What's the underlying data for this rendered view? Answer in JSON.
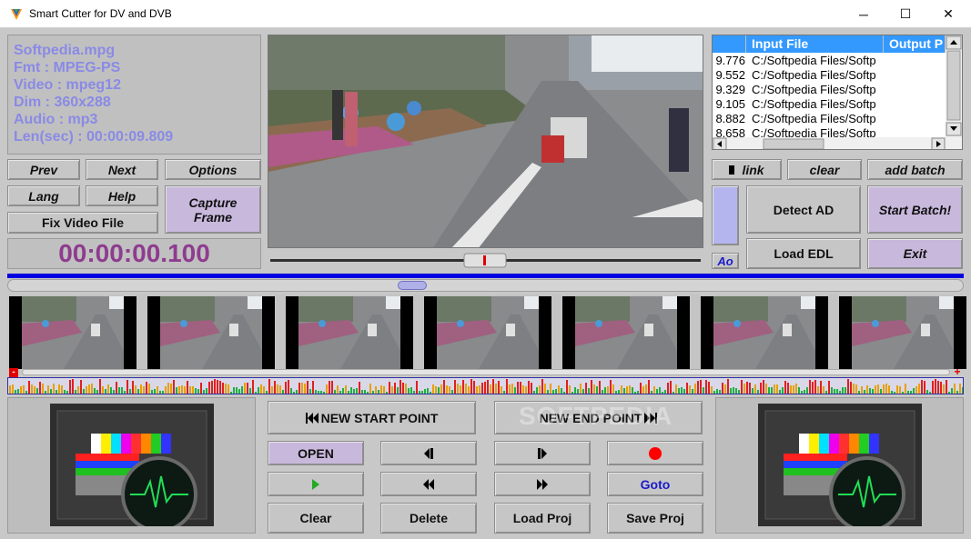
{
  "window": {
    "title": "Smart Cutter for DV and DVB",
    "minimize": "─",
    "maximize": "☐",
    "close": "✕"
  },
  "info": {
    "filename": "Softpedia.mpg",
    "fmt": "Fmt : MPEG-PS",
    "video": "Video : mpeg12",
    "dim": "Dim : 360x288",
    "audio": "Audio : mp3",
    "len": "Len(sec) : 00:00:09.809"
  },
  "left_buttons": {
    "prev": "Prev",
    "next": "Next",
    "options": "Options",
    "lang": "Lang",
    "help": "Help",
    "capture_frame": "Capture Frame",
    "fix_video_file": "Fix Video File"
  },
  "timecode": "00:00:00.100",
  "file_list": {
    "headers": [
      "",
      "Input File",
      "Output P"
    ],
    "rows": [
      {
        "time": "9.776",
        "input": "C:/Softpedia Files/Softp"
      },
      {
        "time": "9.552",
        "input": "C:/Softpedia Files/Softp"
      },
      {
        "time": "9.329",
        "input": "C:/Softpedia Files/Softp"
      },
      {
        "time": "9.105",
        "input": "C:/Softpedia Files/Softp"
      },
      {
        "time": "8.882",
        "input": "C:/Softpedia Files/Softp"
      },
      {
        "time": "8.658",
        "input": "C:/Softpedia Files/Softp"
      }
    ]
  },
  "right_buttons": {
    "link": "link",
    "clear": "clear",
    "add_batch": "add batch",
    "detect_ad": "Detect AD",
    "start_batch": "Start Batch!",
    "load_edl": "Load EDL",
    "exit": "Exit",
    "ao": "Ao"
  },
  "level_markers": {
    "minus": "-",
    "plus": "+"
  },
  "transport": {
    "new_start_point": "NEW START POINT",
    "new_end_point": "NEW END POINT",
    "open": "OPEN",
    "goto": "Goto",
    "clear": "Clear",
    "delete": "Delete",
    "load_proj": "Load Proj",
    "save_proj": "Save Proj"
  },
  "watermark": "SOFTPEDIA",
  "colors": {
    "accent_blue": "#0000e0",
    "info_text": "#8a8ae6",
    "timecode_text": "#8e3c8e",
    "record_red": "#ff0000",
    "play_green": "#22aa22",
    "list_header": "#3399ff"
  },
  "icons": {
    "app": "app-icon",
    "record": "record-icon",
    "play": "play-icon",
    "step_back": "step-back-icon",
    "step_forward": "step-forward-icon",
    "rewind": "rewind-icon",
    "fast_forward": "fast-forward-icon"
  }
}
